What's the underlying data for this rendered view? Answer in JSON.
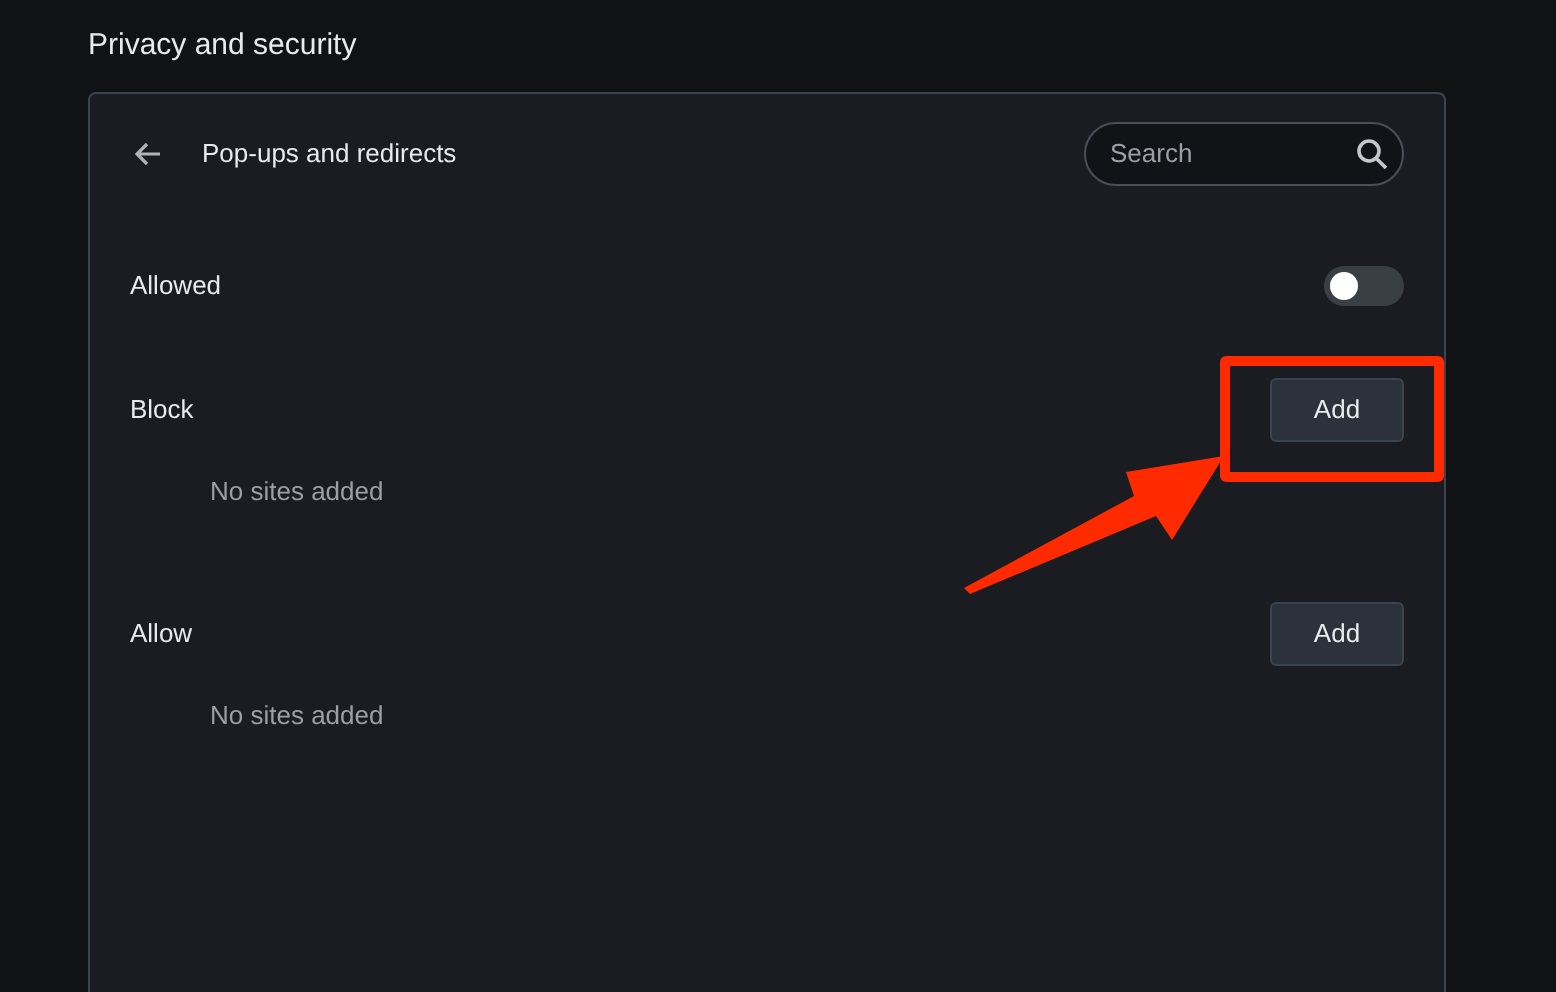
{
  "page_title": "Privacy and security",
  "panel": {
    "title": "Pop-ups and redirects",
    "search": {
      "placeholder": "Search"
    }
  },
  "sections": [
    {
      "kind": "toggle",
      "label": "Allowed",
      "on": false
    },
    {
      "kind": "list",
      "label": "Block",
      "button": "Add",
      "empty_text": "No sites added"
    },
    {
      "kind": "list",
      "label": "Allow",
      "button": "Add",
      "empty_text": "No sites added"
    }
  ]
}
